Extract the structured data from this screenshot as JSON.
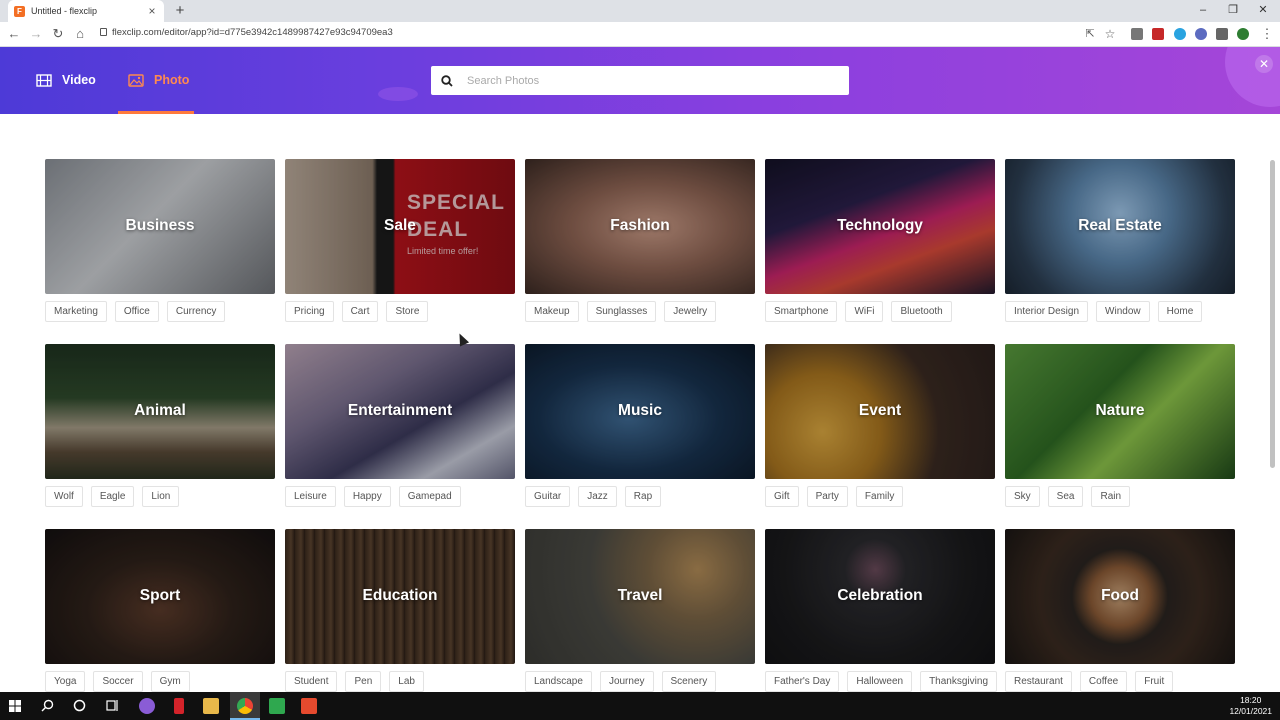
{
  "browser": {
    "tab_title": "Untitled - flexclip",
    "url": "flexclip.com/editor/app?id=d775e3942c1489987427e93c94709ea3"
  },
  "header": {
    "tabs": [
      {
        "label": "Video",
        "icon": "film-icon",
        "active": false
      },
      {
        "label": "Photo",
        "icon": "image-icon",
        "active": true
      }
    ],
    "search_placeholder": "Search Photos",
    "accent": "#ff7a3c"
  },
  "categories": [
    {
      "title": "Business",
      "tags": [
        "Marketing",
        "Office",
        "Currency"
      ]
    },
    {
      "title": "Sale",
      "tags": [
        "Pricing",
        "Cart",
        "Store"
      ],
      "overlay_line1": "SPECIAL",
      "overlay_line2": "DEAL",
      "overlay_sub": "Limited time offer!"
    },
    {
      "title": "Fashion",
      "tags": [
        "Makeup",
        "Sunglasses",
        "Jewelry"
      ]
    },
    {
      "title": "Technology",
      "tags": [
        "Smartphone",
        "WiFi",
        "Bluetooth"
      ]
    },
    {
      "title": "Real Estate",
      "tags": [
        "Interior Design",
        "Window",
        "Home"
      ]
    },
    {
      "title": "Animal",
      "tags": [
        "Wolf",
        "Eagle",
        "Lion"
      ]
    },
    {
      "title": "Entertainment",
      "tags": [
        "Leisure",
        "Happy",
        "Gamepad"
      ]
    },
    {
      "title": "Music",
      "tags": [
        "Guitar",
        "Jazz",
        "Rap"
      ]
    },
    {
      "title": "Event",
      "tags": [
        "Gift",
        "Party",
        "Family"
      ]
    },
    {
      "title": "Nature",
      "tags": [
        "Sky",
        "Sea",
        "Rain"
      ]
    },
    {
      "title": "Sport",
      "tags": [
        "Yoga",
        "Soccer",
        "Gym"
      ]
    },
    {
      "title": "Education",
      "tags": [
        "Student",
        "Pen",
        "Lab"
      ]
    },
    {
      "title": "Travel",
      "tags": [
        "Landscape",
        "Journey",
        "Scenery"
      ]
    },
    {
      "title": "Celebration",
      "tags": [
        "Father's Day",
        "Halloween",
        "Thanksgiving"
      ]
    },
    {
      "title": "Food",
      "tags": [
        "Restaurant",
        "Coffee",
        "Fruit"
      ]
    }
  ],
  "taskbar": {
    "time": "18:20",
    "date": "12/01/2021"
  }
}
